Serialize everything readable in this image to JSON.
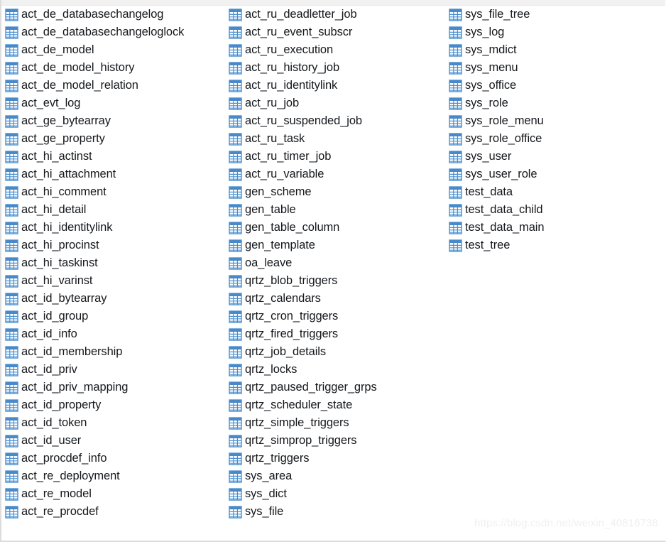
{
  "watermark": "https://blog.csdn.net/weixin_40816738",
  "icon": {
    "name": "database-table-icon",
    "header_color": "#4a89c8",
    "grid_color": "#4a90d0",
    "fill_color": "#ffffff"
  },
  "colors": {
    "text": "#15181c",
    "background": "#ffffff",
    "top_strip": "#f1f1f1",
    "border": "#dcdcdc",
    "watermark": "#f0f0f0"
  },
  "columns": [
    {
      "id": "column-1",
      "tables": [
        "act_de_databasechangelog",
        "act_de_databasechangeloglock",
        "act_de_model",
        "act_de_model_history",
        "act_de_model_relation",
        "act_evt_log",
        "act_ge_bytearray",
        "act_ge_property",
        "act_hi_actinst",
        "act_hi_attachment",
        "act_hi_comment",
        "act_hi_detail",
        "act_hi_identitylink",
        "act_hi_procinst",
        "act_hi_taskinst",
        "act_hi_varinst",
        "act_id_bytearray",
        "act_id_group",
        "act_id_info",
        "act_id_membership",
        "act_id_priv",
        "act_id_priv_mapping",
        "act_id_property",
        "act_id_token",
        "act_id_user",
        "act_procdef_info",
        "act_re_deployment",
        "act_re_model",
        "act_re_procdef"
      ]
    },
    {
      "id": "column-2",
      "tables": [
        "act_ru_deadletter_job",
        "act_ru_event_subscr",
        "act_ru_execution",
        "act_ru_history_job",
        "act_ru_identitylink",
        "act_ru_job",
        "act_ru_suspended_job",
        "act_ru_task",
        "act_ru_timer_job",
        "act_ru_variable",
        "gen_scheme",
        "gen_table",
        "gen_table_column",
        "gen_template",
        "oa_leave",
        "qrtz_blob_triggers",
        "qrtz_calendars",
        "qrtz_cron_triggers",
        "qrtz_fired_triggers",
        "qrtz_job_details",
        "qrtz_locks",
        "qrtz_paused_trigger_grps",
        "qrtz_scheduler_state",
        "qrtz_simple_triggers",
        "qrtz_simprop_triggers",
        "qrtz_triggers",
        "sys_area",
        "sys_dict",
        "sys_file"
      ]
    },
    {
      "id": "column-3",
      "tables": [
        "sys_file_tree",
        "sys_log",
        "sys_mdict",
        "sys_menu",
        "sys_office",
        "sys_role",
        "sys_role_menu",
        "sys_role_office",
        "sys_user",
        "sys_user_role",
        "test_data",
        "test_data_child",
        "test_data_main",
        "test_tree"
      ]
    }
  ]
}
